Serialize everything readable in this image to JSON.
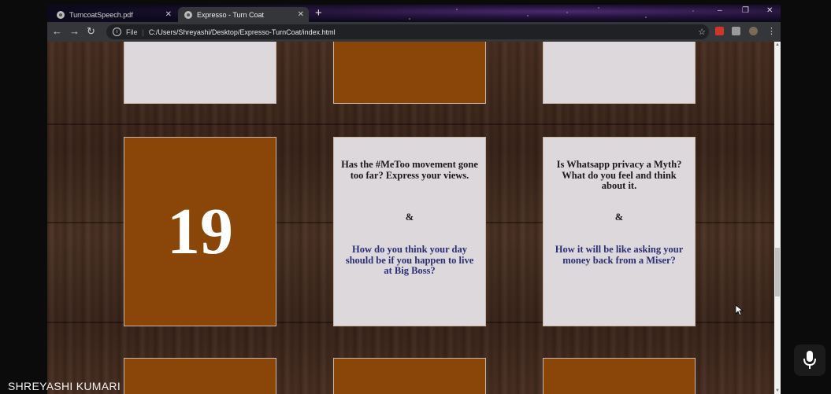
{
  "browser": {
    "tabs": [
      {
        "label": "TurncoatSpeech.pdf",
        "active": false
      },
      {
        "label": "Expresso - Turn Coat",
        "active": true
      }
    ],
    "new_tab_symbol": "+",
    "window_controls": {
      "minimize": "–",
      "restore": "❐",
      "close": "✕"
    },
    "address_bar": {
      "scheme_label": "File",
      "url": "C:/Users/Shreyashi/Desktop/Expresso-TurnCoat/index.html"
    },
    "nav": {
      "back": "←",
      "forward": "→",
      "reload": "↻"
    }
  },
  "page": {
    "cards": {
      "number_card": {
        "value": "19"
      },
      "card_metoo": {
        "question_1": "Has the #MeToo movement gone too far? Express your views.",
        "separator": "&",
        "question_2": "How do you think your day should be if you happen to live at Big Boss?"
      },
      "card_whatsapp": {
        "question_1": "Is Whatsapp privacy a Myth? What do you feel and think about it.",
        "separator": "&",
        "question_2": "How it will be like asking your money back from a Miser?"
      }
    },
    "colors": {
      "card_brown": "#8a4609",
      "card_grey": "#dcd8dc",
      "question_dark": "#1a1a1a",
      "question_blue": "#2b2f73"
    }
  },
  "overlay": {
    "presenter_name": "SHREYASHI KUMARI",
    "mic_icon": "microphone-icon"
  }
}
